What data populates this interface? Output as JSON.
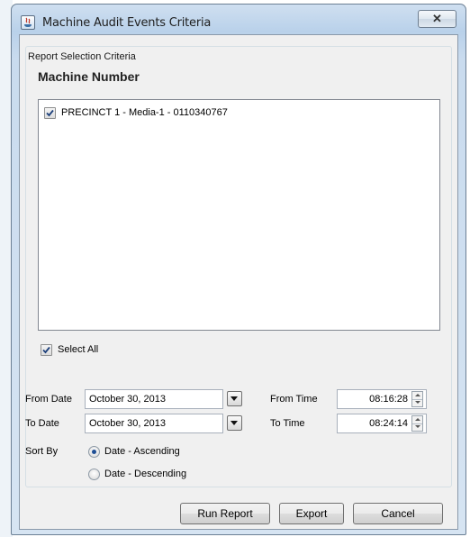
{
  "window": {
    "title": "Machine Audit Events Criteria",
    "close_glyph": "✕"
  },
  "group": {
    "label": "Report Selection Criteria"
  },
  "machines": {
    "heading": "Machine Number",
    "items": [
      {
        "label": "PRECINCT 1 -  Media-1  - 0110340767",
        "checked": true
      }
    ]
  },
  "select_all": {
    "label": "Select All",
    "checked": true
  },
  "from_date": {
    "label": "From Date",
    "value": "October 30, 2013"
  },
  "to_date": {
    "label": "To Date",
    "value": "October 30, 2013"
  },
  "from_time": {
    "label": "From Time",
    "value": "08:16:28"
  },
  "to_time": {
    "label": "To Time",
    "value": "08:24:14"
  },
  "sort": {
    "label": "Sort By",
    "options": [
      {
        "label": "Date - Ascending",
        "selected": true
      },
      {
        "label": "Date - Descending",
        "selected": false
      }
    ]
  },
  "buttons": {
    "run": "Run Report",
    "export": "Export",
    "cancel": "Cancel"
  },
  "colors": {
    "accent": "#1f4f95",
    "check": "#1c3f7a"
  },
  "icons": {
    "app": "java-app-icon",
    "close": "close-icon",
    "dropdown": "chevron-down-icon"
  }
}
